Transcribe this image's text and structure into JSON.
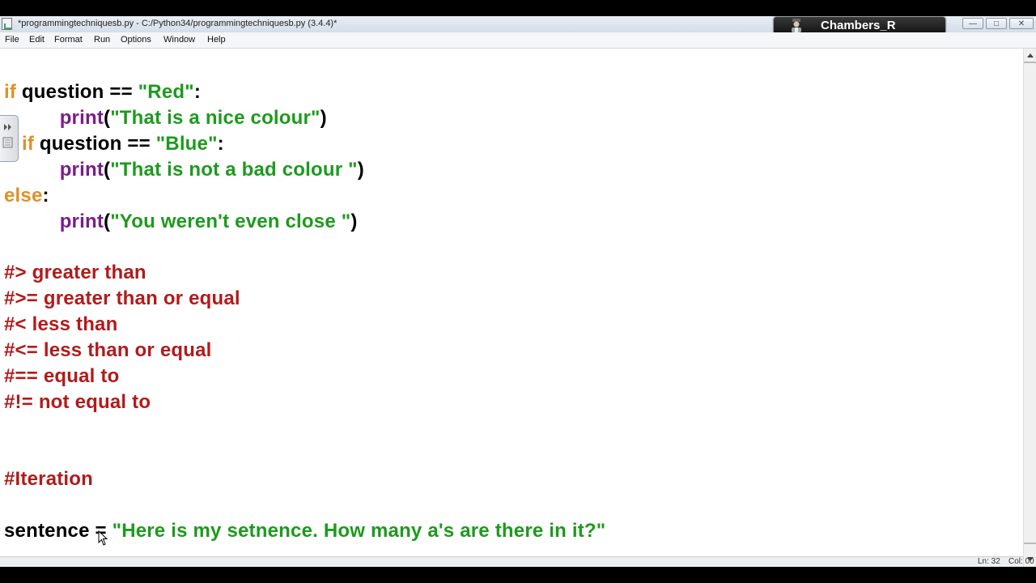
{
  "window": {
    "title": "*programmingtechniquesb.py - C:/Python34/programmingtechniquesb.py (3.4.4)*",
    "user_name": "Chambers_R",
    "controls": {
      "minimize": "—",
      "maximize": "□",
      "close": "✕"
    }
  },
  "menu": {
    "items": [
      "File",
      "Edit",
      "Format",
      "Run",
      "Options",
      "Window",
      "Help"
    ]
  },
  "code": {
    "line1": {
      "kw": "if",
      "rest": " question == ",
      "str": "\"Red\"",
      "end": ":"
    },
    "line2": {
      "indent": "          ",
      "fn": "print",
      "open": "(",
      "str": "\"That is a nice colour\"",
      "close": ")"
    },
    "line3": {
      "kw": "if",
      "rest": " question == ",
      "str": "\"Blue\"",
      "end": ":"
    },
    "line4": {
      "indent": "          ",
      "fn": "print",
      "open": "(",
      "str": "\"That is not a bad colour \"",
      "close": ")"
    },
    "line5": {
      "kw": "else",
      "end": ":"
    },
    "line6": {
      "indent": "          ",
      "fn": "print",
      "open": "(",
      "str": "\"You weren't even close \"",
      "close": ")"
    },
    "comments": [
      "#> greater than",
      "#>= greater than or equal",
      "#< less than",
      "#<= less than or equal",
      "#== equal to",
      "#!= not equal to"
    ],
    "iteration_comment": "#Iteration",
    "sentence_line": {
      "var": "sentence = ",
      "str": "\"Here is my setnence. How many a's are there in it?\""
    }
  },
  "status": {
    "line": "Ln: 32",
    "col": "Col: 00"
  },
  "colors": {
    "keyword": "#e0902a",
    "string": "#1d9a1d",
    "builtin": "#7a1c8c",
    "comment": "#b11b1b"
  }
}
